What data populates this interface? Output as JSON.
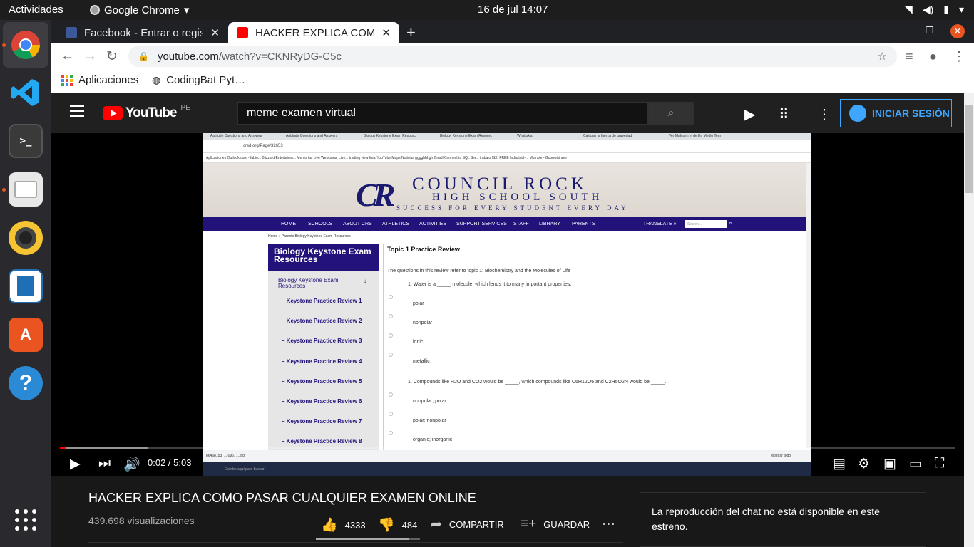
{
  "topbar": {
    "activities": "Actividades",
    "app_name": "Google Chrome",
    "clock": "16 de jul  14:07"
  },
  "chrome": {
    "tabs": [
      {
        "label": "Facebook - Entrar o regist",
        "fav_color": "#3b5998"
      },
      {
        "label": "HACKER EXPLICA COMO P",
        "fav_color": "#ff0000"
      }
    ],
    "url_domain": "youtube.com",
    "url_path": "/watch?v=CKNRyDG-C5c",
    "bookmarks": [
      "Aplicaciones",
      "CodingBat Pyt…"
    ]
  },
  "youtube": {
    "country": "PE",
    "logo_text": "YouTube",
    "search_value": "meme examen virtual",
    "signin_label": "INICIAR SESIÓN",
    "player": {
      "time": "0:02 / 5:03",
      "progress": 0.0066
    },
    "video_title": "HACKER EXPLICA COMO PASAR CUALQUIER EXAMEN ONLINE",
    "views": "439.698 visualizaciones",
    "likes": "4333",
    "dislikes": "484",
    "share_label": "COMPARTIR",
    "save_label": "GUARDAR",
    "like_ratio": 0.9,
    "chat_message": "La reproducción del chat no está disponible en este estreno."
  },
  "embedded_page": {
    "inner_tabs": [
      "Aptitude Questions and Answers",
      "Aptitude Questions and Answers",
      "Biology Keystone Exam Resourc",
      "Biology Keystone Exam Resourc",
      "WhatsApp",
      "Calcular la fuerza de gravedad",
      "Ver Malcolm el de En Medio Tem"
    ],
    "inner_url": "crsd.org/Page/32653",
    "inner_bookmarks": "Aplicaciones   Outlook.com - fabio...   Blizzard Entertainm...   Memorias   Live Webcams: Live...   trading view   fmiz   YouTube   Maps   Noticias   gggghhhgh   Gmail   Connect to SQL Ser...   trabajo   ISX: FREE Industrial-...   Mumble - Goonwiki   ave",
    "logo_letters": "CR",
    "school_name": "COUNCIL ROCK",
    "school_sub": "HIGH SCHOOL SOUTH",
    "motto": "SUCCESS FOR EVERY STUDENT EVERY DAY",
    "nav": [
      "HOME",
      "SCHOOLS",
      "ABOUT CRS",
      "ATHLETICS",
      "ACTIVITIES",
      "SUPPORT SERVICES",
      "STAFF",
      "LIBRARY",
      "PARENTS"
    ],
    "translate": "TRANSLATE »",
    "search_placeholder": "Search...",
    "breadcrumb": "Home  »  Parents     Biology Keystone Exam Resources",
    "sidebar_title": "Biology Keystone Exam Resources",
    "sidebar_sub": "Biology Keystone Exam Resources",
    "sidebar_links": [
      "Keystone Practice Review 1",
      "Keystone Practice Review 2",
      "Keystone Practice Review 3",
      "Keystone Practice Review 4",
      "Keystone Practice Review 5",
      "Keystone Practice Review 6",
      "Keystone Practice Review 7",
      "Keystone Practice Review 8"
    ],
    "content_title": "Topic 1 Practice Review",
    "intro": "The questions in this review refer to topic 1: Biochemistry and the Molecules of Life",
    "q1": "1. Water is a _____ molecule, which lends it to many important properties.",
    "q1_options": [
      "polar",
      "nonpolar",
      "ionic",
      "metallic"
    ],
    "q2": "1. Compounds like H2O and CO2 would be _____, which compounds like C6H12O6 and C2H5O2N would be _____.",
    "q2_options": [
      "nonpolar; polar",
      "polar; nonpolar",
      "organic; inorganic"
    ],
    "download_file": "86468153_170967....jpg",
    "show_all": "Mostrar todo",
    "taskbar_search": "Escribe aquí para buscar"
  }
}
